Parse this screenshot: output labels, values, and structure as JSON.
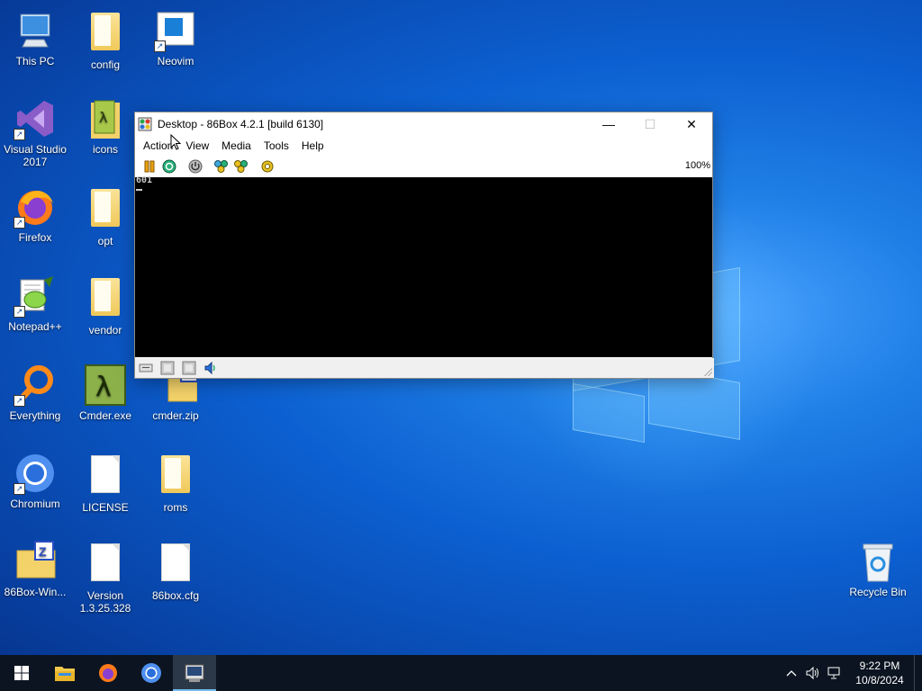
{
  "desktop": {
    "icons": [
      {
        "label": "This PC"
      },
      {
        "label": "config"
      },
      {
        "label": "Neovim"
      },
      {
        "label": "Visual Studio 2017"
      },
      {
        "label": "icons"
      },
      {
        "label": "Firefox"
      },
      {
        "label": "opt"
      },
      {
        "label": "Notepad++"
      },
      {
        "label": "vendor"
      },
      {
        "label": "Everything"
      },
      {
        "label": "Cmder.exe"
      },
      {
        "label": "cmder.zip"
      },
      {
        "label": "Chromium"
      },
      {
        "label": "LICENSE"
      },
      {
        "label": "roms"
      },
      {
        "label": "86Box-Win..."
      },
      {
        "label": "Version 1.3.25.328"
      },
      {
        "label": "86box.cfg"
      },
      {
        "label": "Recycle Bin"
      }
    ]
  },
  "window": {
    "title": "Desktop - 86Box 4.2.1 [build 6130]",
    "menu": [
      "Action",
      "View",
      "Media",
      "Tools",
      "Help"
    ],
    "zoom": "100%",
    "screen_text": "601"
  },
  "taskbar": {
    "time": "9:22 PM",
    "date": "10/8/2024"
  },
  "colors": {
    "accent": "#76b9ed",
    "taskbar": "#0b1420",
    "wallpaper": "#0c5fd0"
  }
}
